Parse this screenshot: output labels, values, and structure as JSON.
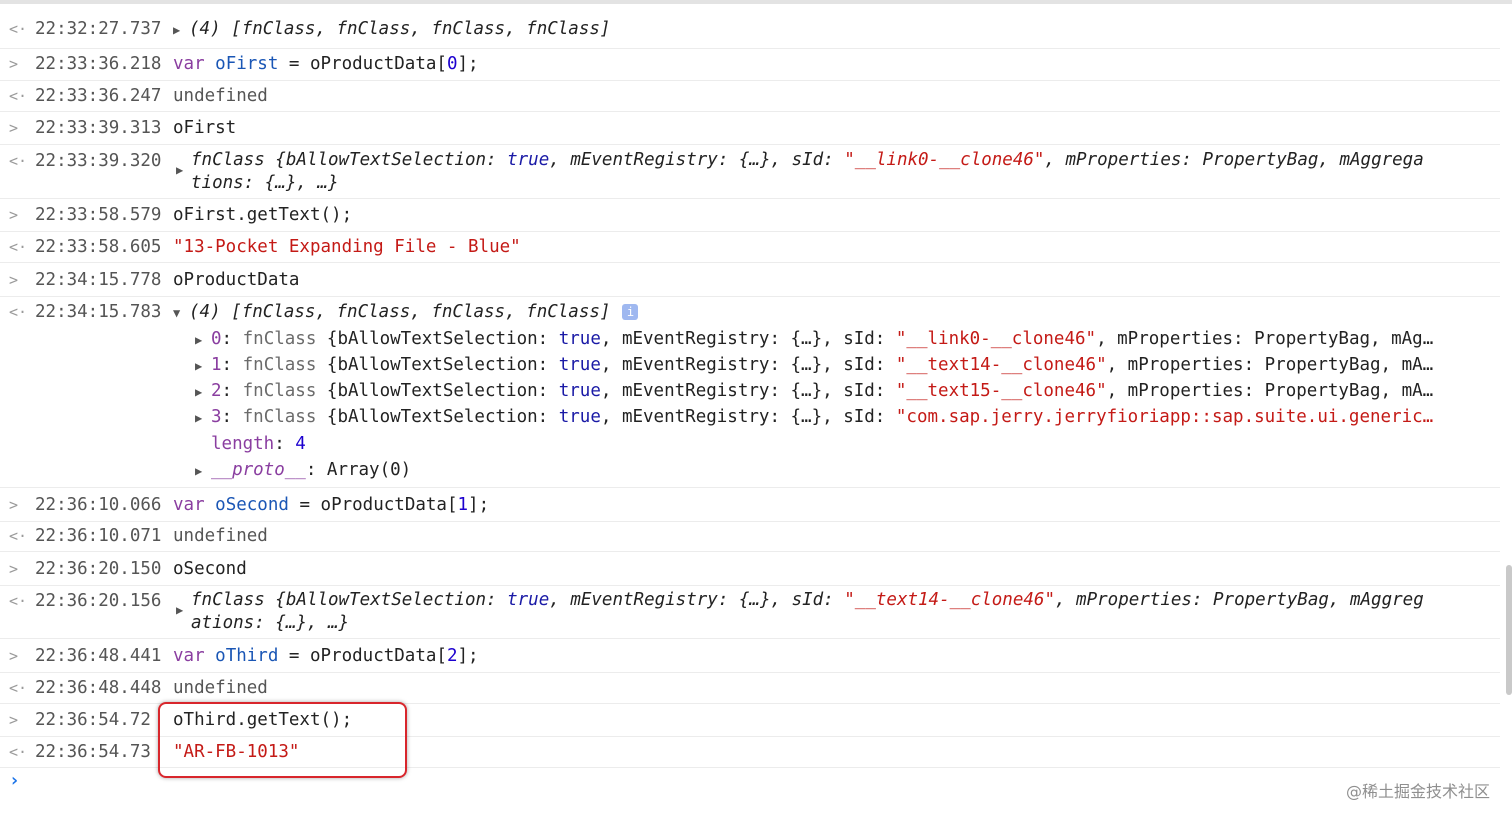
{
  "console": {
    "r1": {
      "ts": "22:32:27.737",
      "count": "(4)",
      "items": "[fnClass, fnClass, fnClass, fnClass]"
    },
    "r2": {
      "ts": "22:33:36.218",
      "kw": "var",
      "var": "oFirst",
      "eq": " = ",
      "expr": "oProductData[",
      "idx": "0",
      "end": "];"
    },
    "r3": {
      "ts": "22:33:36.247",
      "val": "undefined"
    },
    "r4": {
      "ts": "22:33:39.313",
      "val": "oFirst"
    },
    "r5": {
      "ts": "22:33:39.320",
      "cls": "fnClass",
      "a": " {bAllowTextSelection: ",
      "b": "true",
      "c": ", mEventRegistry: {…}, sId: ",
      "d": "\"__link0-__clone46\"",
      "e": ", mProperties: PropertyBag, mAggrega",
      "l2": "tions: {…}, …}"
    },
    "r6": {
      "ts": "22:33:58.579",
      "val": "oFirst.getText();"
    },
    "r7": {
      "ts": "22:33:58.605",
      "val": "\"13-Pocket Expanding File - Blue\""
    },
    "r8": {
      "ts": "22:34:15.778",
      "val": "oProductData"
    },
    "r9": {
      "ts": "22:34:15.783",
      "count": "(4)",
      "items": "[fnClass, fnClass, fnClass, fnClass]",
      "info": "i"
    },
    "children": {
      "c0": {
        "idx": "0",
        "sep": ": ",
        "cls": "fnClass",
        "a": " {bAllowTextSelection: ",
        "b": "true",
        "c": ", mEventRegistry: {…}, sId: ",
        "d": "\"__link0-__clone46\"",
        "e": ", mProperties: PropertyBag, mAg…"
      },
      "c1": {
        "idx": "1",
        "sep": ": ",
        "cls": "fnClass",
        "a": " {bAllowTextSelection: ",
        "b": "true",
        "c": ", mEventRegistry: {…}, sId: ",
        "d": "\"__text14-__clone46\"",
        "e": ", mProperties: PropertyBag, mA…"
      },
      "c2": {
        "idx": "2",
        "sep": ": ",
        "cls": "fnClass",
        "a": " {bAllowTextSelection: ",
        "b": "true",
        "c": ", mEventRegistry: {…}, sId: ",
        "d": "\"__text15-__clone46\"",
        "e": ", mProperties: PropertyBag, mA…"
      },
      "c3": {
        "idx": "3",
        "sep": ": ",
        "cls": "fnClass",
        "a": " {bAllowTextSelection: ",
        "b": "true",
        "c": ", mEventRegistry: {…}, sId: ",
        "d": "\"com.sap.jerry.jerryfioriapp::sap.suite.ui.generic…"
      },
      "length": {
        "key": "length",
        "sep": ": ",
        "val": "4"
      },
      "proto": {
        "key": "__proto__",
        "sep": ": ",
        "val": "Array(0)"
      }
    },
    "r10": {
      "ts": "22:36:10.066",
      "kw": "var",
      "var": "oSecond",
      "eq": " = ",
      "expr": "oProductData[",
      "idx": "1",
      "end": "];"
    },
    "r11": {
      "ts": "22:36:10.071",
      "val": "undefined"
    },
    "r12": {
      "ts": "22:36:20.150",
      "val": "oSecond"
    },
    "r13": {
      "ts": "22:36:20.156",
      "cls": "fnClass",
      "a": " {bAllowTextSelection: ",
      "b": "true",
      "c": ", mEventRegistry: {…}, sId: ",
      "d": "\"__text14-__clone46\"",
      "e": ", mProperties: PropertyBag, mAggreg",
      "l2": "ations: {…}, …}"
    },
    "r14": {
      "ts": "22:36:48.441",
      "kw": "var",
      "var": "oThird",
      "eq": " = ",
      "expr": "oProductData[",
      "idx": "2",
      "end": "];"
    },
    "r15": {
      "ts": "22:36:48.448",
      "val": "undefined"
    },
    "r16": {
      "ts": "22:36:54.72",
      "val": "oThird.getText();"
    },
    "r17": {
      "ts": "22:36:54.73",
      "val": "\"AR-FB-1013\""
    }
  },
  "icons": {
    "input": "chevron-right-icon",
    "output": "return-arrow-icon",
    "expanded": "triangle-down-icon",
    "collapsed": "triangle-right-icon"
  },
  "colors": {
    "keyword": "#8a3ea0",
    "variable": "#1a56b5",
    "string": "#c41a16",
    "number": "#1c00cf",
    "highlight": "#d8262c",
    "prompt": "#1a73e8"
  },
  "watermark": "@稀土掘金技术社区"
}
